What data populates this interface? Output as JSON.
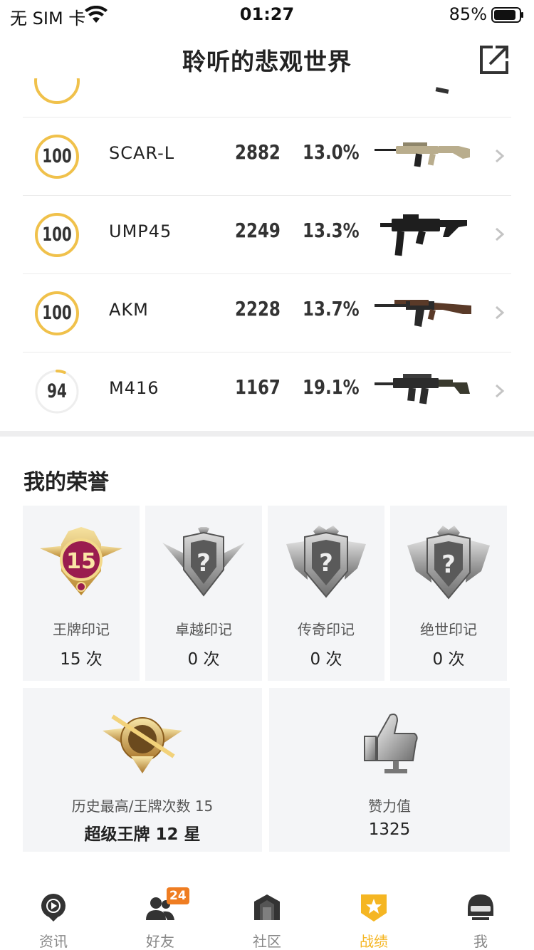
{
  "status_bar": {
    "carrier": "无 SIM 卡",
    "time": "01:27",
    "battery_percent": "85%",
    "battery_level": 0.85
  },
  "nav": {
    "title": "聆听的悲观世界",
    "share_icon": "share-external-icon"
  },
  "weapons": {
    "rows": [
      {
        "mastery": "100",
        "mastery_fraction": 1.0,
        "name": "SCAR-L",
        "kills": "2882",
        "rate": "13.0%",
        "gun_icon": "scar-l-rifle-icon",
        "gun_color": "#b9ad8d"
      },
      {
        "mastery": "100",
        "mastery_fraction": 1.0,
        "name": "UMP45",
        "kills": "2249",
        "rate": "13.3%",
        "gun_icon": "ump45-smg-icon",
        "gun_color": "#1e1e1e"
      },
      {
        "mastery": "100",
        "mastery_fraction": 1.0,
        "name": "AKM",
        "kills": "2228",
        "rate": "13.7%",
        "gun_icon": "akm-rifle-icon",
        "gun_color": "#5a3a28"
      },
      {
        "mastery": "94",
        "mastery_fraction": 0.06,
        "name": "M416",
        "kills": "1167",
        "rate": "19.1%",
        "gun_icon": "m416-rifle-icon",
        "gun_color": "#2c2c2c"
      }
    ]
  },
  "honors": {
    "title": "我的荣誉",
    "badges": [
      {
        "label": "王牌印记",
        "value": "15 次",
        "icon": "ace-emblem-icon",
        "badge_number": "15"
      },
      {
        "label": "卓越印记",
        "value": "0 次",
        "icon": "excellence-emblem-locked-icon",
        "badge_number": "?"
      },
      {
        "label": "传奇印记",
        "value": "0 次",
        "icon": "legend-emblem-locked-icon",
        "badge_number": "?"
      },
      {
        "label": "绝世印记",
        "value": "0 次",
        "icon": "peerless-emblem-locked-icon",
        "badge_number": "?"
      }
    ],
    "highest": {
      "label": "历史最高/王牌次数 15",
      "value": "超级王牌 12 星",
      "icon": "super-ace-badge-icon"
    },
    "likes": {
      "label": "赞力值",
      "value": "1325",
      "icon": "thumbs-up-trophy-icon"
    }
  },
  "tabs": [
    {
      "label": "资讯",
      "icon": "news-play-icon",
      "active": false
    },
    {
      "label": "好友",
      "icon": "friends-icon",
      "active": false,
      "badge": "24"
    },
    {
      "label": "社区",
      "icon": "community-house-icon",
      "active": false
    },
    {
      "label": "战绩",
      "icon": "record-shield-icon",
      "active": true
    },
    {
      "label": "我",
      "icon": "helmet-profile-icon",
      "active": false
    }
  ],
  "colors": {
    "accent": "#f5b623",
    "ring_gold": "#f0c14b",
    "ring_track": "#eeeeee",
    "badge_orange": "#ef7d22",
    "tab_inactive": "#888888"
  }
}
